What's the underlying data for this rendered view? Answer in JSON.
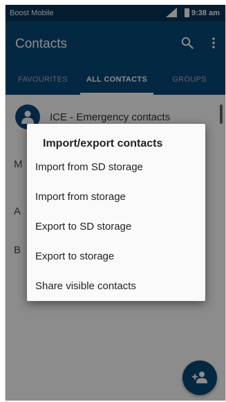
{
  "status_bar": {
    "carrier": "Boost Mobile",
    "time": "9:38 am"
  },
  "app_bar": {
    "title": "Contacts"
  },
  "tabs": [
    {
      "label": "FAVOURITES"
    },
    {
      "label": "ALL CONTACTS"
    },
    {
      "label": "GROUPS"
    }
  ],
  "active_tab": "ALL CONTACTS",
  "contacts": {
    "ice_label": "ICE - Emergency contacts",
    "section_letters": [
      "M",
      "A",
      "B"
    ]
  },
  "dialog": {
    "title": "Import/export contacts",
    "options": [
      {
        "label": "Import from SD storage"
      },
      {
        "label": "Import from storage"
      },
      {
        "label": "Export to SD storage"
      },
      {
        "label": "Export to storage"
      },
      {
        "label": "Share visible contacts"
      }
    ]
  },
  "colors": {
    "status_bar": "#083658",
    "app_bar": "#0a4a78",
    "fab": "#0a4a78",
    "tab_inactive": "#9fb7cb",
    "tab_active": "#ffffff"
  },
  "icons": {
    "search": "search-icon",
    "more": "more-vert-icon",
    "signal": "signal-icon",
    "battery": "battery-icon",
    "avatar": "person-icon",
    "fab": "add-contact-icon"
  }
}
